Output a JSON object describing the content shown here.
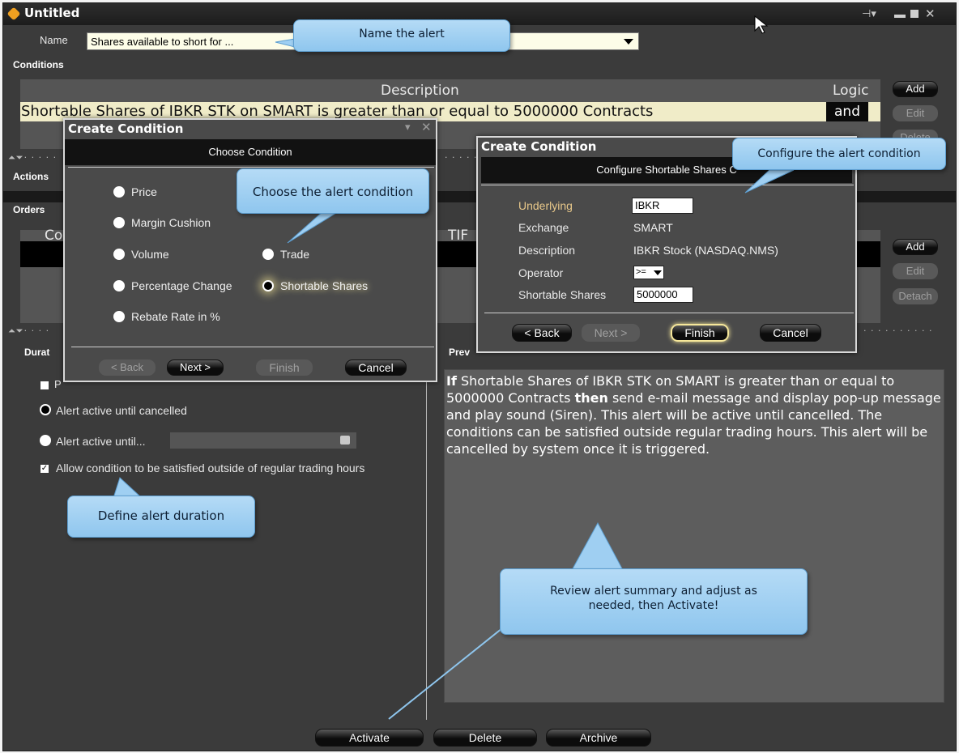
{
  "window": {
    "title": "Untitled",
    "controls": [
      "pin",
      "minimize",
      "maximize",
      "close"
    ]
  },
  "name_field": {
    "label": "Name",
    "value": "Shares available to short for ..."
  },
  "sections": {
    "conditions": "Conditions",
    "actions": "Actions",
    "orders": "Orders",
    "duration": "Durat",
    "preview": "Prev"
  },
  "conditions_table": {
    "col_description": "Description",
    "col_logic": "Logic",
    "row_text": "Shortable Shares  of IBKR STK on SMART is greater than or equal to 5000000 Contracts",
    "row_logic": "and",
    "buttons": {
      "add": "Add",
      "edit": "Edit",
      "delete": "Delete"
    }
  },
  "orders_table": {
    "col_first": "Co",
    "col_tif": "TIF",
    "buttons": {
      "add": "Add",
      "edit": "Edit",
      "detach": "Detach"
    }
  },
  "duration": {
    "option_p_partial": "P",
    "until_cancelled": "Alert active until cancelled",
    "until": "Alert active until...",
    "outside_rth": "Allow condition to be satisfied outside of regular trading hours",
    "outside_rth_checked": true,
    "selected": "until_cancelled"
  },
  "preview": {
    "if": "If",
    "part1": " Shortable Shares of IBKR STK on SMART is greater than or equal to 5000000 Contracts ",
    "then": "then",
    "part2": " send e-mail message and display pop-up message and play sound (Siren). This alert will be active until cancelled. The conditions can be satisfied outside regular trading hours. This alert will be cancelled by system once it is triggered."
  },
  "bottom_buttons": {
    "activate": "Activate",
    "delete": "Delete",
    "archive": "Archive"
  },
  "dialog_choose": {
    "title": "Create Condition",
    "header": "Choose Condition",
    "options": {
      "price": "Price",
      "margin_cushion": "Margin Cushion",
      "volume": "Volume",
      "trade": "Trade",
      "percentage_change": "Percentage Change",
      "shortable_shares": "Shortable Shares",
      "rebate_rate": "Rebate Rate in %"
    },
    "selected": "Shortable Shares",
    "buttons": {
      "back": "< Back",
      "next": "Next >",
      "finish": "Finish",
      "cancel": "Cancel"
    }
  },
  "dialog_configure": {
    "title": "Create Condition",
    "header": "Configure Shortable Shares  C",
    "fields": {
      "underlying_label": "Underlying",
      "underlying_value": "IBKR",
      "exchange_label": "Exchange",
      "exchange_value": "SMART",
      "description_label": "Description",
      "description_value": "IBKR Stock (NASDAQ.NMS)",
      "operator_label": "Operator",
      "operator_value": ">=",
      "shares_label": "Shortable Shares",
      "shares_value": "5000000"
    },
    "buttons": {
      "back": "< Back",
      "next": "Next >",
      "finish": "Finish",
      "cancel": "Cancel"
    }
  },
  "callouts": {
    "name": "Name the alert",
    "choose": "Choose the alert condition",
    "configure": "Configure the alert condition",
    "duration": "Define alert duration",
    "review_line1": "Review alert summary and adjust as",
    "review_line2": "needed, then Activate!"
  },
  "colors": {
    "window_bg": "#3b3b3b",
    "panel_bg": "#555555",
    "condition_row": "#f0ecc8",
    "callout": "#a6d2f3",
    "finish_highlight": "#f6e79a"
  }
}
